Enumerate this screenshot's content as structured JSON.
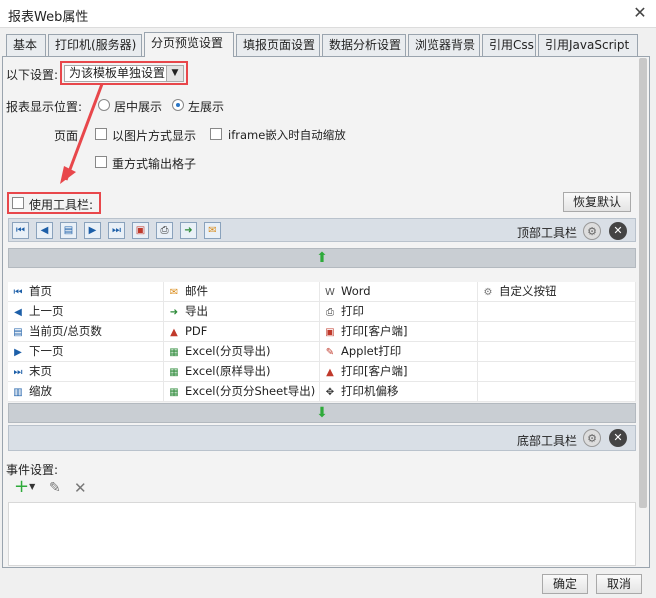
{
  "window": {
    "title": "报表Web属性",
    "close_glyph": "✕"
  },
  "tabs": [
    {
      "label": "基本"
    },
    {
      "label": "打印机(服务器)"
    },
    {
      "label": "分页预览设置",
      "active": true
    },
    {
      "label": "填报页面设置"
    },
    {
      "label": "数据分析设置"
    },
    {
      "label": "浏览器背景"
    },
    {
      "label": "引用Css"
    },
    {
      "label": "引用JavaScript"
    }
  ],
  "settings": {
    "scope_label": "以下设置:",
    "scope_value": "为该模板单独设置",
    "position_label": "报表显示位置:",
    "position_options": [
      "居中展示",
      "左展示"
    ],
    "position_selected": "左展示",
    "page_label": "页面",
    "page_options": [
      "以图片方式显示",
      "iframe嵌入时自动缩放",
      "重方式输出格子"
    ],
    "use_toolbar_label": "使用工具栏:",
    "restore_default": "恢复默认"
  },
  "toolbar": {
    "top_label": "顶部工具栏",
    "bottom_label": "底部工具栏",
    "arrow_up": "⬆",
    "arrow_down": "⬇"
  },
  "buttons_grid": [
    [
      "首页",
      "邮件",
      "Word",
      "自定义按钮"
    ],
    [
      "上一页",
      "导出",
      "打印",
      ""
    ],
    [
      "当前页/总页数",
      "PDF",
      "打印[客户端]",
      ""
    ],
    [
      "下一页",
      "Excel(分页导出)",
      "Applet打印",
      ""
    ],
    [
      "末页",
      "Excel(原样导出)",
      "打印[客户端]",
      ""
    ],
    [
      "缩放",
      "Excel(分页分Sheet导出)",
      "打印机偏移",
      ""
    ]
  ],
  "events": {
    "label": "事件设置:"
  },
  "footer": {
    "ok": "确定",
    "cancel": "取消"
  },
  "colors": {
    "highlight": "#e8474b",
    "toolbar_blue": "#1d5fa8",
    "add_green": "#2eaa3a"
  }
}
